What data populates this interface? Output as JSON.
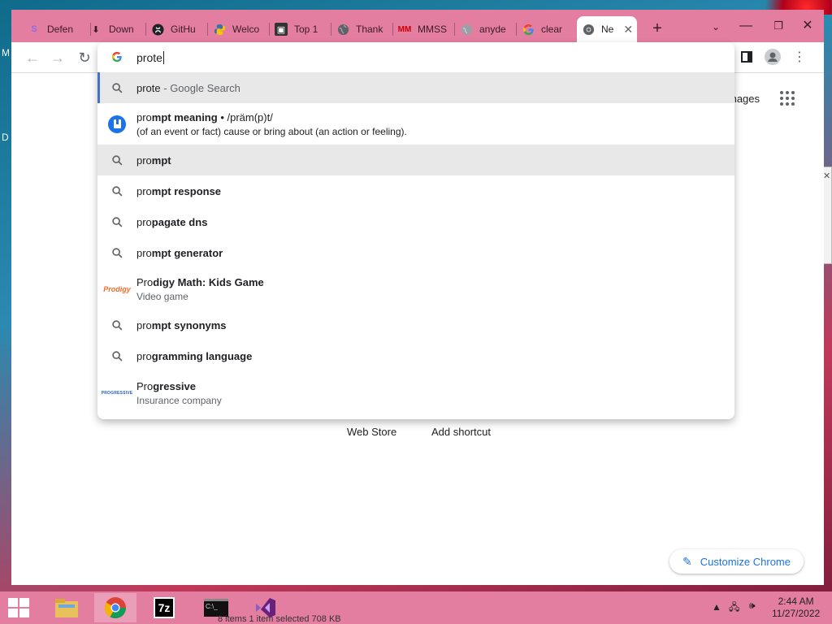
{
  "desktop": {
    "side_letters": [
      "M",
      "D"
    ]
  },
  "tabs": [
    {
      "title": "Defen",
      "icon": "s-logo-icon",
      "color": "#8e6be8"
    },
    {
      "title": "Down",
      "icon": "download-icon",
      "color": "#5f6368"
    },
    {
      "title": "GitHu",
      "icon": "github-icon",
      "color": "#202124"
    },
    {
      "title": "Welco",
      "icon": "python-icon",
      "color": "#3572a5"
    },
    {
      "title": "Top 1",
      "icon": "box-icon",
      "color": "#333333"
    },
    {
      "title": "Thank",
      "icon": "globe-icon",
      "color": "#5f6368"
    },
    {
      "title": "MMSS",
      "icon": "mm-logo-icon",
      "color": "#cc0000"
    },
    {
      "title": "anyde",
      "icon": "globe-icon",
      "color": "#9aa0a6"
    },
    {
      "title": "clear",
      "icon": "google-icon",
      "color": "#4285f4"
    },
    {
      "title": "Ne",
      "icon": "chrome-icon",
      "color": "#5f6368",
      "active": true
    }
  ],
  "omnibox": {
    "typed": "prote",
    "suggestions": [
      {
        "type": "search",
        "prefix": "prote",
        "rest": "",
        "hint": " - Google Search",
        "selected": true
      },
      {
        "type": "dictionary",
        "prefix": "pro",
        "rest": "mpt meaning",
        "pron": " • /präm(p)t/",
        "sub": "(of an event or fact) cause or bring about (an action or feeling)."
      },
      {
        "type": "search",
        "prefix": "pro",
        "rest": "mpt",
        "hover": true
      },
      {
        "type": "search",
        "prefix": "pro",
        "rest": "mpt response"
      },
      {
        "type": "search",
        "prefix": "pro",
        "rest": "pagate dns"
      },
      {
        "type": "search",
        "prefix": "pro",
        "rest": "mpt generator"
      },
      {
        "type": "entity",
        "prefix": "Pro",
        "rest": "digy Math: Kids Game",
        "sub": "Video game",
        "logo": "Prodigy"
      },
      {
        "type": "search",
        "prefix": "pro",
        "rest": "mpt synonyms"
      },
      {
        "type": "search",
        "prefix": "pro",
        "rest": "gramming language"
      },
      {
        "type": "entity",
        "prefix": "Pro",
        "rest": "gressive",
        "sub": "Insurance company",
        "logo": "PROGRESSIVE"
      }
    ]
  },
  "ntp": {
    "images_link": "mages",
    "shortcuts": [
      "Web Store",
      "Add shortcut"
    ],
    "customize": "Customize Chrome"
  },
  "taskbar": {
    "explorer_status": "8 items    1 item selected  708 KB",
    "time": "2:44 AM",
    "date": "11/27/2022"
  }
}
